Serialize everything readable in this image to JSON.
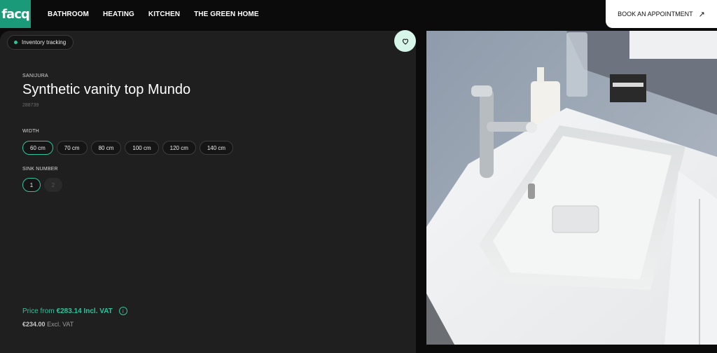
{
  "logo": "facq",
  "nav": {
    "items": [
      "BATHROOM",
      "HEATING",
      "KITCHEN",
      "THE GREEN HOME"
    ],
    "book_label": "BOOK AN APPOINTMENT"
  },
  "badge": {
    "label": "Inventory tracking"
  },
  "product": {
    "brand": "SANIJURA",
    "title": "Synthetic vanity top Mundo",
    "sku": "288739"
  },
  "width": {
    "label": "WIDTH",
    "options": [
      "60 cm",
      "70 cm",
      "80 cm",
      "100 cm",
      "120 cm",
      "140 cm"
    ],
    "selected": "60 cm"
  },
  "sinks": {
    "label": "SINK NUMBER",
    "options": [
      "1",
      "2"
    ],
    "selected": "1"
  },
  "price": {
    "prefix": "Price from",
    "incl": "€283.14 Incl. VAT",
    "excl_value": "€234.00",
    "excl_suffix": "Excl. VAT"
  },
  "colors": {
    "accent": "#2fc39b",
    "brand_green": "#1a9a78",
    "panel": "#1f1f1f"
  },
  "icons": {
    "favorite": "heart-icon",
    "info": "info-icon",
    "book": "arrow-up-right-icon",
    "status": "status-dot-icon"
  }
}
